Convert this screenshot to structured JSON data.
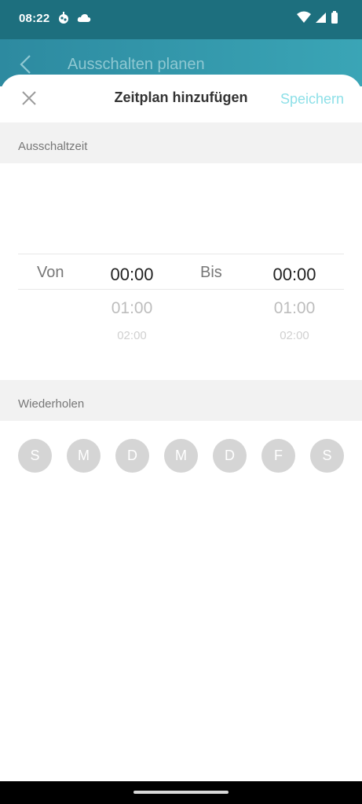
{
  "status_bar": {
    "time": "08:22",
    "left_icons": [
      "app-notification-icon",
      "cloud-icon"
    ],
    "right_icons": [
      "wifi-icon",
      "signal-icon",
      "battery-icon"
    ]
  },
  "background_screen": {
    "title": "Ausschalten planen"
  },
  "sheet": {
    "title": "Zeitplan hinzufügen",
    "save_label": "Speichern",
    "section_time": "Ausschaltzeit",
    "section_repeat": "Wiederholen"
  },
  "picker": {
    "from_label": "Von",
    "to_label": "Bis",
    "from_values": [
      "00:00",
      "01:00",
      "02:00"
    ],
    "to_values": [
      "00:00",
      "01:00",
      "02:00"
    ]
  },
  "days": [
    "S",
    "M",
    "D",
    "M",
    "D",
    "F",
    "S"
  ],
  "colors": {
    "accent": "#8ee0e8",
    "header": "#2d8aa0",
    "day_inactive": "#d5d5d5"
  }
}
